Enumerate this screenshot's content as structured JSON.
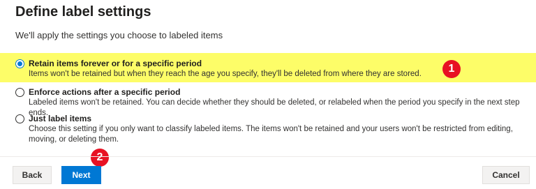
{
  "title": "Define label settings",
  "subtitle": "We'll apply the settings you choose to labeled items",
  "options": [
    {
      "label": "Retain items forever or for a specific period",
      "description": "Items won't be retained but when they reach the age you specify, they'll be deleted from where they are stored.",
      "checked": true
    },
    {
      "label": "Enforce actions after a specific period",
      "description": "Labeled items won't be retained. You can decide whether they should be deleted, or relabeled when the period you specify in the next step ends.",
      "checked": false
    },
    {
      "label": "Just label items",
      "description": "Choose this setting if you only want to classify labeled items. The items won't be retained and your users won't be restricted from editing, moving, or deleting them.",
      "checked": false
    }
  ],
  "badges": {
    "first": "1",
    "second": "2"
  },
  "buttons": {
    "back": "Back",
    "next": "Next",
    "cancel": "Cancel"
  },
  "colors": {
    "highlight": "#fdfd68",
    "accent": "#0078d4",
    "badge": "#e81123"
  }
}
